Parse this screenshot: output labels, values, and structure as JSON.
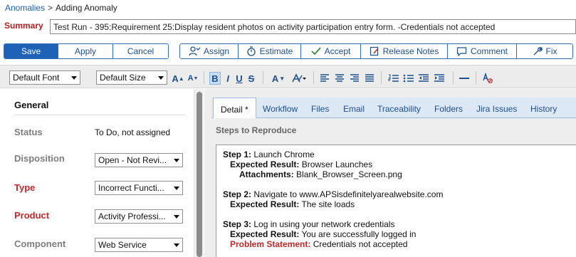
{
  "breadcrumb": {
    "parent": "Anomalies",
    "separator": ">",
    "current": "Adding Anomaly"
  },
  "summary": {
    "label": "Summary",
    "value": "Test Run - 395:Requirement 25:Display resident photos on activity participation entry form. -Credentials not accepted"
  },
  "action_buttons": {
    "save": "Save",
    "apply": "Apply",
    "cancel": "Cancel"
  },
  "workflow_buttons": {
    "assign": "Assign",
    "estimate": "Estimate",
    "accept": "Accept",
    "release_notes": "Release Notes",
    "comment": "Comment",
    "fix": "Fix"
  },
  "editor_toolbar": {
    "font": "Default Font",
    "size": "Default Size",
    "bold": "B",
    "italic": "I",
    "underline": "U",
    "strike": "S"
  },
  "general": {
    "title": "General",
    "fields": [
      {
        "label": "Status",
        "value": "To Do, not assigned"
      },
      {
        "label": "Disposition",
        "value": "Open - Not Revi..."
      },
      {
        "label": "Type",
        "value": "Incorrect Functi..."
      },
      {
        "label": "Product",
        "value": "Activity Professi..."
      },
      {
        "label": "Component",
        "value": "Web Service"
      }
    ]
  },
  "tabs": [
    "Detail *",
    "Workflow",
    "Files",
    "Email",
    "Traceability",
    "Folders",
    "Jira Issues",
    "History"
  ],
  "steps": {
    "title": "Steps to Reproduce",
    "lines": [
      {
        "bold": "Step 1:",
        "text": " Launch Chrome"
      },
      {
        "bold": "Expected Result:",
        "text": " Browser Launches"
      },
      {
        "bold": "Attachments:",
        "text": " Blank_Browser_Screen.png"
      },
      {
        "bold": "Step 2:",
        "text": " Navigate to www.APSisdefinitelyarealwebsite.com"
      },
      {
        "bold": "Expected Result:",
        "text": " The site loads"
      },
      {
        "bold": "Step 3:",
        "text": " Log in using your network credentials"
      },
      {
        "bold": "Expected Result:",
        "text": " You are successfully logged in"
      },
      {
        "bold": "Problem Statement:",
        "text": " Credentials not accepted"
      }
    ]
  },
  "colors": {
    "accent": "#1e62b8",
    "required": "#c0282a",
    "tab_bg": "#dce8f6"
  }
}
